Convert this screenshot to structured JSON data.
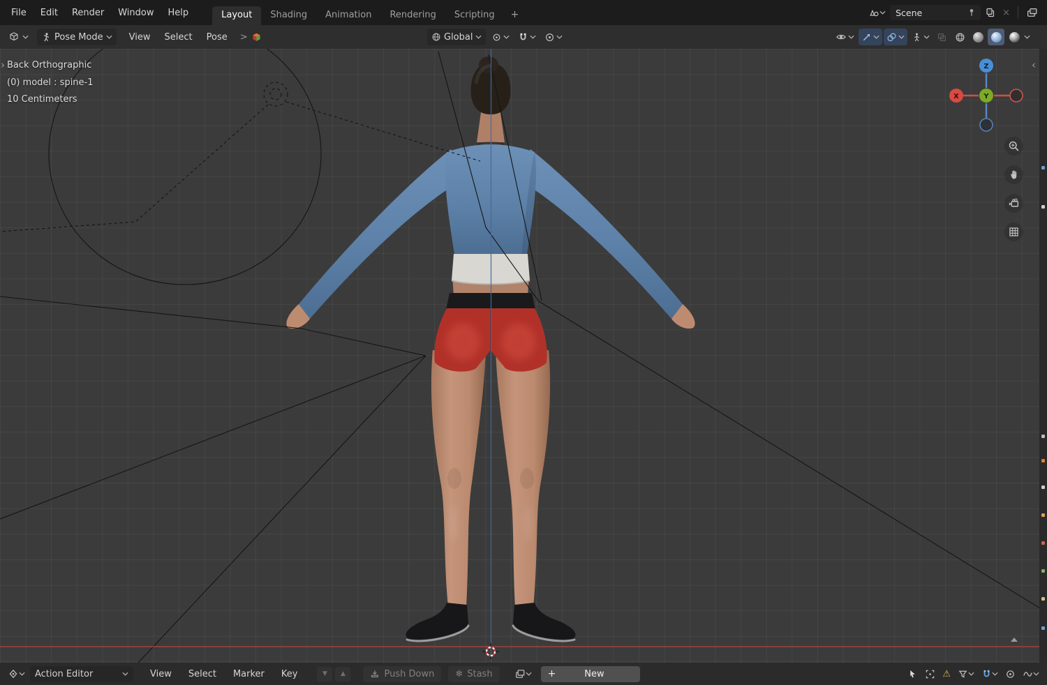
{
  "topbar": {
    "menus": [
      "File",
      "Edit",
      "Render",
      "Window",
      "Help"
    ],
    "tabs": [
      {
        "label": "Layout",
        "active": true
      },
      {
        "label": "Shading",
        "active": false
      },
      {
        "label": "Animation",
        "active": false
      },
      {
        "label": "Rendering",
        "active": false
      },
      {
        "label": "Scripting",
        "active": false
      }
    ],
    "add_tab": "+",
    "scene": {
      "label": "Scene"
    }
  },
  "viewport_header": {
    "mode": "Pose Mode",
    "menus": [
      "View",
      "Select",
      "Pose"
    ],
    "breadcrumb_arrow": ">",
    "orientation": "Global"
  },
  "viewport": {
    "info_line_1": "Back Orthographic",
    "info_line_2": "(0) model : spine-1",
    "info_line_3": "10 Centimeters",
    "axis_x": "X",
    "axis_y": "Y",
    "axis_z": "Z"
  },
  "dopesheet": {
    "editor": "Action Editor",
    "menus": [
      "View",
      "Select",
      "Marker",
      "Key"
    ],
    "push_down": "Push Down",
    "stash": "Stash",
    "new_button": "New"
  },
  "icons": {
    "triangle_down": "▼",
    "triangle_up": "▲",
    "warning": "⚠",
    "snowflake": "❄",
    "plus": "+",
    "close": "×",
    "left_panel_toggle": "›",
    "right_panel_toggle": "‹"
  },
  "colors": {
    "accent_blue": "#4772b3",
    "axis_x_red": "#d84a42",
    "axis_y_green": "#7bab28",
    "axis_z_blue": "#4a8fd6",
    "sweater_blue": "#5d81a8",
    "shorts_red": "#b13129",
    "viewport_bg": "#3b3b3b"
  }
}
